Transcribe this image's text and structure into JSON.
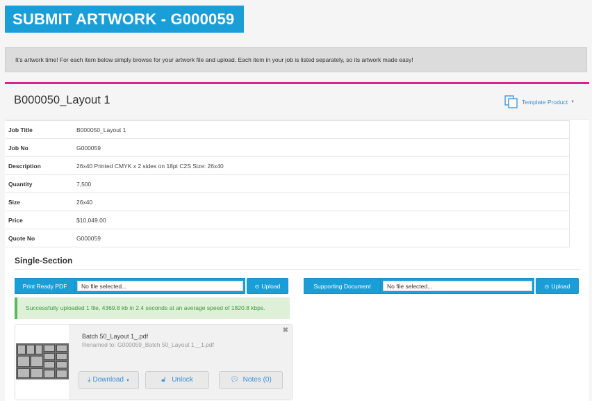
{
  "header": {
    "title": "SUBMIT ARTWORK - G000059"
  },
  "banner": {
    "text": "It's artwork time! For each item below simply browse for your artwork file and upload. Each item in your job is listed separately, so its artwork made easy!"
  },
  "panel": {
    "title": "B000050_Layout 1",
    "template_button": "Template Product",
    "accent_color": "#e01e8c"
  },
  "details": [
    {
      "label": "Job Title",
      "value": "B000050_Layout 1"
    },
    {
      "label": "Job No",
      "value": "G000059"
    },
    {
      "label": "Description",
      "value": "26x40 Printed CMYK x 2 sides on 18pt C2S Size: 26x40"
    },
    {
      "label": "Quantity",
      "value": "7,500"
    },
    {
      "label": "Size",
      "value": "26x40"
    },
    {
      "label": "Price",
      "value": "$10,049.00"
    },
    {
      "label": "Quote No",
      "value": "G000059"
    }
  ],
  "section": {
    "title": "Single-Section",
    "print_ready": {
      "label": "Print Ready PDF",
      "field_value": "No file selected...",
      "upload_label": "Upload"
    },
    "supporting": {
      "label": "Supporting Document",
      "field_value": "No file selected...",
      "upload_label": "Upload"
    },
    "success_message": "Successfully uploaded 1 file, 4369.8 kb in 2.4 seconds at an average speed of 1820.8 kbps."
  },
  "file_card": {
    "file_name": "Batch 50_Layout 1_.pdf",
    "renamed": "Renamed to: G000059_Batch 50_Layout 1__1.pdf",
    "close": "✖",
    "download_label": "Download",
    "unlock_label": "Unlock",
    "notes_label": "Notes (0)"
  },
  "colors": {
    "brand_blue": "#1a9ed8",
    "success_green": "#5cb85c",
    "link_blue": "#3a8fd6"
  }
}
